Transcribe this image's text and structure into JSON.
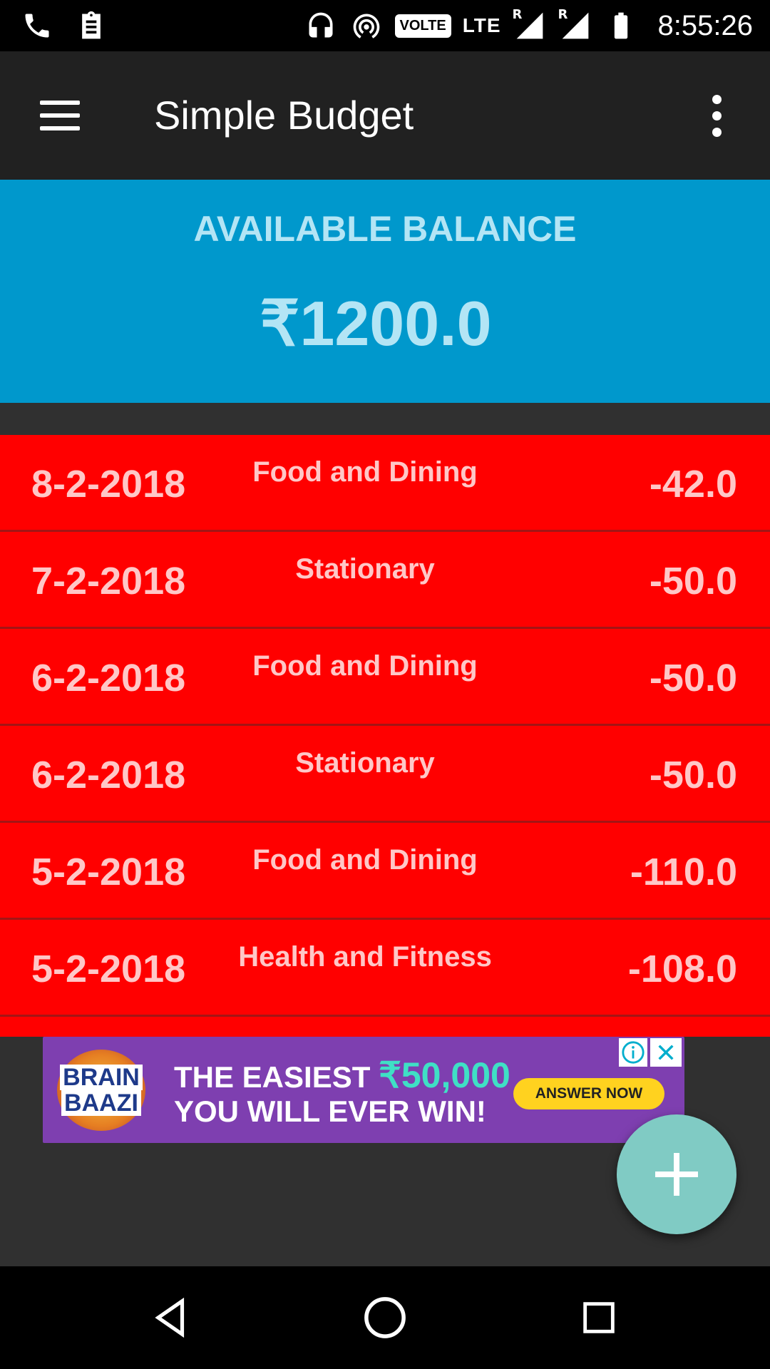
{
  "status_bar": {
    "network_label": "VOLTE",
    "lte_label": "LTE",
    "roaming_1": "R",
    "roaming_2": "R",
    "time": "8:55:26",
    "icons": [
      "phone-icon",
      "clipboard-icon",
      "headset-icon",
      "hotspot-icon",
      "volte-icon",
      "signal-icon",
      "signal-icon",
      "battery-icon"
    ]
  },
  "app_bar": {
    "title": "Simple Budget",
    "icons": [
      "menu-icon",
      "overflow-menu-icon"
    ]
  },
  "balance": {
    "label": "AVAILABLE BALANCE",
    "value": "₹1200.0",
    "color": "#0098CC"
  },
  "transactions": [
    {
      "date": "8-2-2018",
      "category": "Food and Dining",
      "amount": "-42.0"
    },
    {
      "date": "7-2-2018",
      "category": "Stationary",
      "amount": "-50.0"
    },
    {
      "date": "6-2-2018",
      "category": "Food and Dining",
      "amount": "-50.0"
    },
    {
      "date": "6-2-2018",
      "category": "Stationary",
      "amount": "-50.0"
    },
    {
      "date": "5-2-2018",
      "category": "Food and Dining",
      "amount": "-110.0"
    },
    {
      "date": "5-2-2018",
      "category": "Health and Fitness",
      "amount": "-108.0"
    }
  ],
  "row_color": "#FF0000",
  "ad": {
    "logo_line1": "BRAIN",
    "logo_line2": "BAAZI",
    "line1_prefix": "THE EASIEST ",
    "line1_amount": "₹50,000",
    "line2": "YOU WILL EVER WIN!",
    "cta": "ANSWER NOW",
    "icons": [
      "info-icon",
      "close-icon"
    ]
  },
  "fab": {
    "icon": "plus-icon",
    "color": "#80CBC4"
  },
  "nav_bar": {
    "icons": [
      "back-icon",
      "home-icon",
      "recents-icon"
    ]
  }
}
